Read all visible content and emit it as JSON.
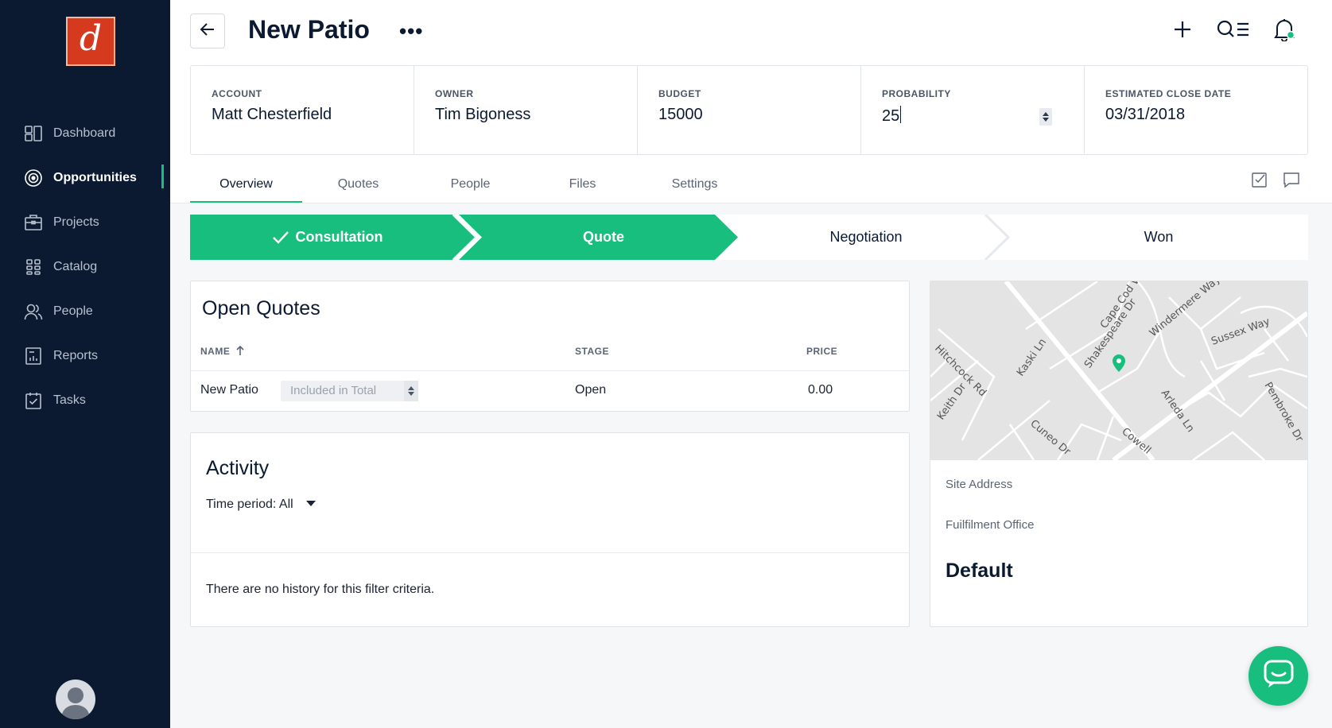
{
  "app": {
    "logo_letter": "d",
    "accent_color": "#17be7e",
    "sidebar_color": "#0b1a31",
    "logo_color": "#d63a1e"
  },
  "sidebar": {
    "items": [
      {
        "label": "Dashboard",
        "icon": "dashboard-icon"
      },
      {
        "label": "Opportunities",
        "icon": "target-icon",
        "active": true
      },
      {
        "label": "Projects",
        "icon": "briefcase-icon"
      },
      {
        "label": "Catalog",
        "icon": "grid-icon"
      },
      {
        "label": "People",
        "icon": "people-icon"
      },
      {
        "label": "Reports",
        "icon": "reports-icon"
      },
      {
        "label": "Tasks",
        "icon": "tasks-icon"
      }
    ]
  },
  "header": {
    "title": "New Patio",
    "more": "•••",
    "actions": [
      "plus-icon",
      "search-list-icon",
      "bell-icon"
    ]
  },
  "summary": {
    "account": {
      "label": "ACCOUNT",
      "value": "Matt Chesterfield"
    },
    "owner": {
      "label": "OWNER",
      "value": "Tim Bigoness"
    },
    "budget": {
      "label": "BUDGET",
      "value": "15000"
    },
    "probability": {
      "label": "PROBABILITY",
      "value": "25"
    },
    "close_date": {
      "label": "ESTIMATED CLOSE DATE",
      "value": "03/31/2018"
    }
  },
  "tabs": [
    {
      "label": "Overview",
      "active": true
    },
    {
      "label": "Quotes"
    },
    {
      "label": "People"
    },
    {
      "label": "Files"
    },
    {
      "label": "Settings"
    }
  ],
  "pipeline": {
    "stages": [
      {
        "label": "Consultation",
        "state": "completed",
        "icon": "check-icon"
      },
      {
        "label": "Quote",
        "state": "current"
      },
      {
        "label": "Negotiation",
        "state": "upcoming"
      },
      {
        "label": "Won",
        "state": "upcoming"
      }
    ]
  },
  "open_quotes": {
    "title": "Open Quotes",
    "columns": {
      "name": "NAME",
      "stage": "STAGE",
      "price": "PRICE"
    },
    "rows": [
      {
        "name": "New Patio",
        "total_option": "Included in Total",
        "stage": "Open",
        "price": "0.00"
      }
    ]
  },
  "activity": {
    "title": "Activity",
    "time_period_label": "Time period:",
    "time_period_value": "All",
    "empty_message": "There are no history for this filter criteria."
  },
  "site": {
    "map_streets": [
      "Cape Cod Way",
      "Windermere Way",
      "Sussex Way",
      "Hitchcock Rd",
      "Kaski Ln",
      "Shakespeare Dr",
      "Keith Dr",
      "Arleda Ln",
      "Pembroke Dr",
      "Cuneo Dr",
      "Cowell"
    ],
    "address_label": "Site Address",
    "office_label": "Fuilfilment Office",
    "office_value": "Default"
  }
}
